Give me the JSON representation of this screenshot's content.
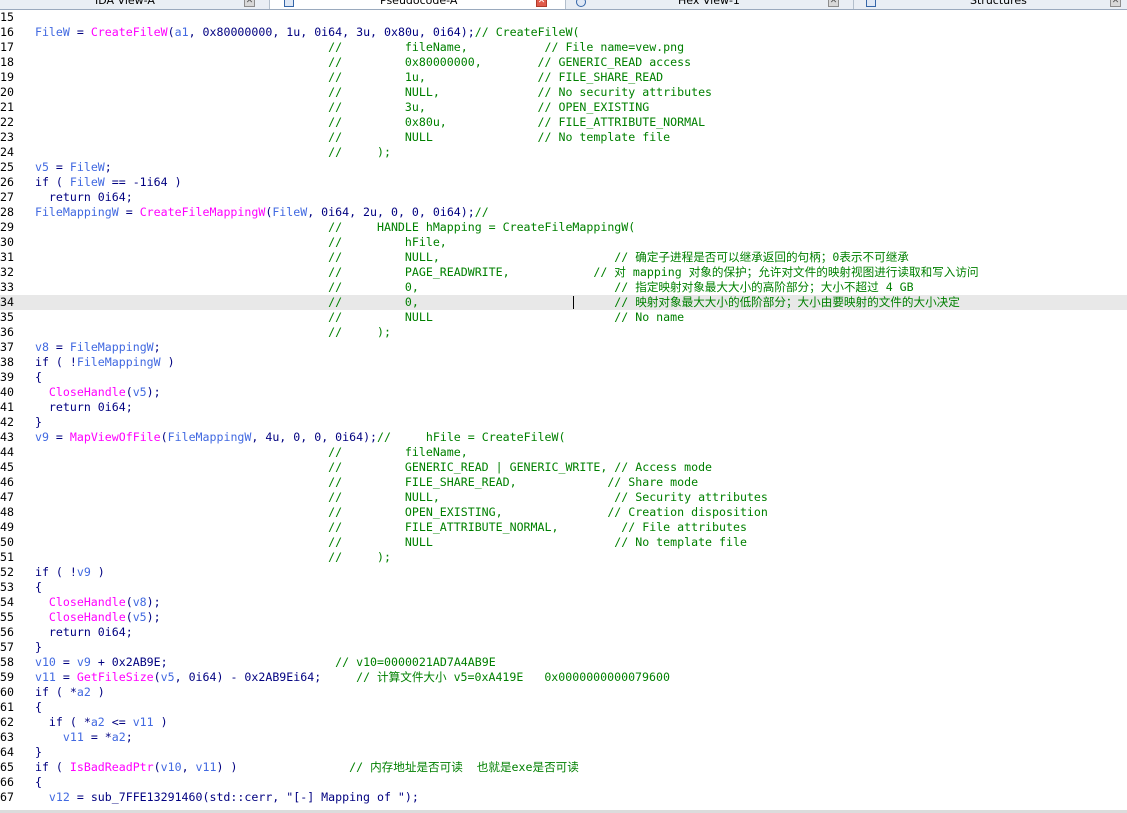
{
  "tabs": [
    {
      "label": "IDA View-A",
      "icon": "ida-view-icon",
      "active": false
    },
    {
      "label": "Pseudocode-A",
      "icon": "pseudocode-icon",
      "active": true
    },
    {
      "label": "Hex View-1",
      "icon": "hex-view-icon",
      "active": false
    },
    {
      "label": "Structures",
      "icon": "structures-icon",
      "active": false
    }
  ],
  "colors": {
    "code": "#000080",
    "comment": "#008000",
    "function": "#ff00ff",
    "variable": "#4169e1",
    "current_line": "#e8e8e8"
  },
  "current_line_number": "34",
  "lines": [
    {
      "n": "15",
      "code": "",
      "comment": ""
    },
    {
      "n": "16",
      "code": "  FileW = CreateFileW(a1, 0x80000000, 1u, 0i64, 3u, 0x80u, 0i64);",
      "comment": "// CreateFileW("
    },
    {
      "n": "17",
      "code": "",
      "comment": "                                            //         fileName,           // File name=vew.png"
    },
    {
      "n": "18",
      "code": "",
      "comment": "                                            //         0x80000000,        // GENERIC_READ access"
    },
    {
      "n": "19",
      "code": "",
      "comment": "                                            //         1u,                // FILE_SHARE_READ"
    },
    {
      "n": "20",
      "code": "",
      "comment": "                                            //         NULL,              // No security attributes"
    },
    {
      "n": "21",
      "code": "",
      "comment": "                                            //         3u,                // OPEN_EXISTING"
    },
    {
      "n": "22",
      "code": "",
      "comment": "                                            //         0x80u,             // FILE_ATTRIBUTE_NORMAL"
    },
    {
      "n": "23",
      "code": "",
      "comment": "                                            //         NULL               // No template file"
    },
    {
      "n": "24",
      "code": "",
      "comment": "                                            //     );"
    },
    {
      "n": "25",
      "code": "  v5 = FileW;",
      "comment": ""
    },
    {
      "n": "26",
      "code": "  if ( FileW == -1i64 )",
      "comment": ""
    },
    {
      "n": "27",
      "code": "    return 0i64;",
      "comment": ""
    },
    {
      "n": "28",
      "code": "  FileMappingW = CreateFileMappingW(FileW, 0i64, 2u, 0, 0, 0i64);",
      "comment": "//"
    },
    {
      "n": "29",
      "code": "",
      "comment": "                                            //     HANDLE hMapping = CreateFileMappingW("
    },
    {
      "n": "30",
      "code": "",
      "comment": "                                            //         hFile,"
    },
    {
      "n": "31",
      "code": "",
      "comment": "                                            //         NULL,                         // 确定子进程是否可以继承返回的句柄；0表示不可继承"
    },
    {
      "n": "32",
      "code": "",
      "comment": "                                            //         PAGE_READWRITE,            // 对 mapping 对象的保护；允许对文件的映射视图进行读取和写入访问"
    },
    {
      "n": "33",
      "code": "",
      "comment": "                                            //         0,                            // 指定映射对象最大大小的高阶部分；大小不超过 4 GB"
    },
    {
      "n": "34",
      "code": "",
      "comment": "                                            //         0,                            // 映射对象最大大小的低阶部分；大小由要映射的文件的大小决定"
    },
    {
      "n": "35",
      "code": "",
      "comment": "                                            //         NULL                          // No name"
    },
    {
      "n": "36",
      "code": "",
      "comment": "                                            //     );"
    },
    {
      "n": "37",
      "code": "  v8 = FileMappingW;",
      "comment": ""
    },
    {
      "n": "38",
      "code": "  if ( !FileMappingW )",
      "comment": ""
    },
    {
      "n": "39",
      "code": "  {",
      "comment": ""
    },
    {
      "n": "40",
      "code": "    CloseHandle(v5);",
      "comment": ""
    },
    {
      "n": "41",
      "code": "    return 0i64;",
      "comment": ""
    },
    {
      "n": "42",
      "code": "  }",
      "comment": ""
    },
    {
      "n": "43",
      "code": "  v9 = MapViewOfFile(FileMappingW, 4u, 0, 0, 0i64);",
      "comment": "//     hFile = CreateFileW("
    },
    {
      "n": "44",
      "code": "",
      "comment": "                                            //         fileName,"
    },
    {
      "n": "45",
      "code": "",
      "comment": "                                            //         GENERIC_READ | GENERIC_WRITE, // Access mode"
    },
    {
      "n": "46",
      "code": "",
      "comment": "                                            //         FILE_SHARE_READ,             // Share mode"
    },
    {
      "n": "47",
      "code": "",
      "comment": "                                            //         NULL,                         // Security attributes"
    },
    {
      "n": "48",
      "code": "",
      "comment": "                                            //         OPEN_EXISTING,               // Creation disposition"
    },
    {
      "n": "49",
      "code": "",
      "comment": "                                            //         FILE_ATTRIBUTE_NORMAL,         // File attributes"
    },
    {
      "n": "50",
      "code": "",
      "comment": "                                            //         NULL                          // No template file"
    },
    {
      "n": "51",
      "code": "",
      "comment": "                                            //     );"
    },
    {
      "n": "52",
      "code": "  if ( !v9 )",
      "comment": ""
    },
    {
      "n": "53",
      "code": "  {",
      "comment": ""
    },
    {
      "n": "54",
      "code": "    CloseHandle(v8);",
      "comment": ""
    },
    {
      "n": "55",
      "code": "    CloseHandle(v5);",
      "comment": ""
    },
    {
      "n": "56",
      "code": "    return 0i64;",
      "comment": ""
    },
    {
      "n": "57",
      "code": "  }",
      "comment": ""
    },
    {
      "n": "58",
      "code": "  v10 = v9 + 0x2AB9E;                        ",
      "comment": "// v10=0000021AD7A4AB9E"
    },
    {
      "n": "59",
      "code": "  v11 = GetFileSize(v5, 0i64) - 0x2AB9Ei64;     ",
      "comment": "// 计算文件大小 v5=0xA419E   0x0000000000079600"
    },
    {
      "n": "60",
      "code": "  if ( *a2 )",
      "comment": ""
    },
    {
      "n": "61",
      "code": "  {",
      "comment": ""
    },
    {
      "n": "62",
      "code": "    if ( *a2 <= v11 )",
      "comment": ""
    },
    {
      "n": "63",
      "code": "      v11 = *a2;",
      "comment": ""
    },
    {
      "n": "64",
      "code": "  }",
      "comment": ""
    },
    {
      "n": "65",
      "code": "  if ( IsBadReadPtr(v10, v11) )                ",
      "comment": "// 内存地址是否可读  也就是exe是否可读"
    },
    {
      "n": "66",
      "code": "  {",
      "comment": ""
    },
    {
      "n": "67",
      "code": "    v12 = sub_7FFE13291460(std::cerr, \"[-] Mapping of \");",
      "comment": ""
    }
  ]
}
